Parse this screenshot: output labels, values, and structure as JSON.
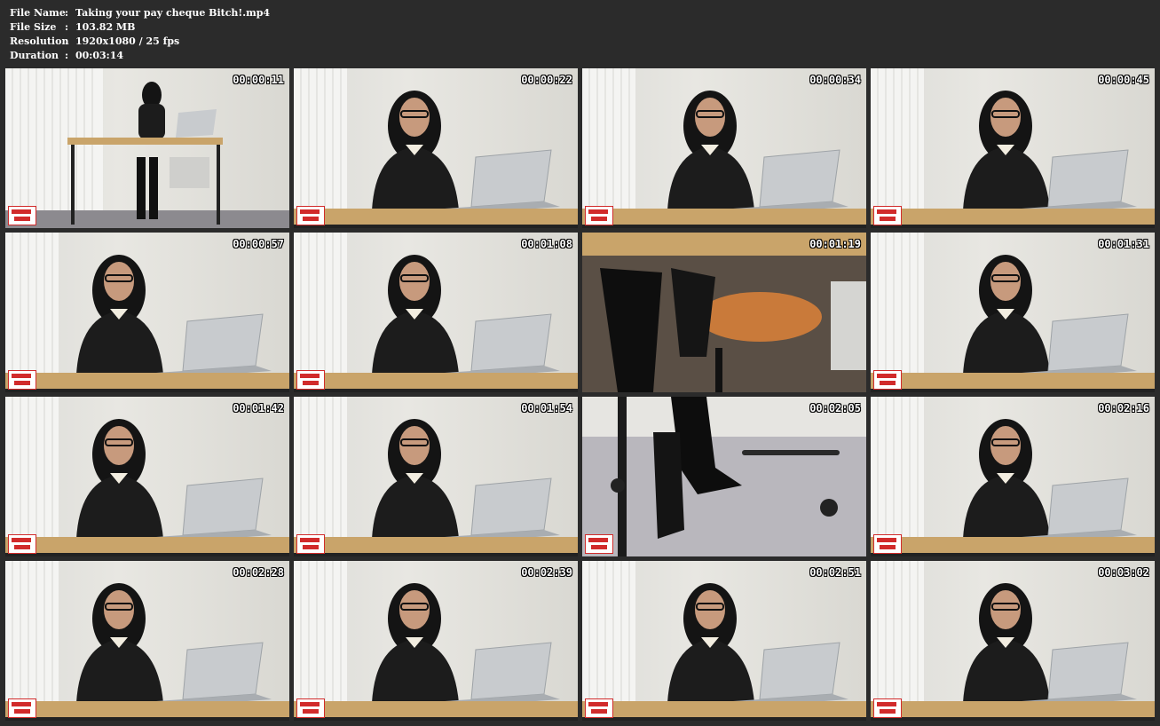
{
  "file_info": {
    "rows": [
      {
        "label": "File Name",
        "sep": ":",
        "value": "Taking your pay cheque Bitch!.mp4"
      },
      {
        "label": "File Size",
        "sep": ":",
        "value": "103.82 MB"
      },
      {
        "label": "Resolution",
        "sep": ":",
        "value": "1920x1080 / 25 fps"
      },
      {
        "label": "Duration",
        "sep": ":",
        "value": "00:03:14"
      }
    ]
  },
  "thumbnails": [
    {
      "time": "00:00:11",
      "scene": "wide",
      "watermark": true
    },
    {
      "time": "00:00:22",
      "scene": "desk",
      "watermark": true
    },
    {
      "time": "00:00:34",
      "scene": "desk",
      "watermark": true
    },
    {
      "time": "00:00:45",
      "scene": "desk",
      "watermark": true
    },
    {
      "time": "00:00:57",
      "scene": "desk",
      "watermark": true
    },
    {
      "time": "00:01:08",
      "scene": "desk",
      "watermark": true
    },
    {
      "time": "00:01:19",
      "scene": "under-desk",
      "watermark": false
    },
    {
      "time": "00:01:31",
      "scene": "desk",
      "watermark": true
    },
    {
      "time": "00:01:42",
      "scene": "desk",
      "watermark": true
    },
    {
      "time": "00:01:54",
      "scene": "desk",
      "watermark": true
    },
    {
      "time": "00:02:05",
      "scene": "boots",
      "watermark": true
    },
    {
      "time": "00:02:16",
      "scene": "desk",
      "watermark": true
    },
    {
      "time": "00:02:28",
      "scene": "desk",
      "watermark": true
    },
    {
      "time": "00:02:39",
      "scene": "desk",
      "watermark": true
    },
    {
      "time": "00:02:51",
      "scene": "desk",
      "watermark": true
    },
    {
      "time": "00:03:02",
      "scene": "desk",
      "watermark": true
    }
  ],
  "colors": {
    "background": "#2b2b2b",
    "text": "#ffffff",
    "wall": "#e4e3de",
    "desk": "#c9a46a",
    "outfit": "#1c1c1c",
    "laptop": "#c8cbce",
    "watermark": "#d12b2b"
  }
}
